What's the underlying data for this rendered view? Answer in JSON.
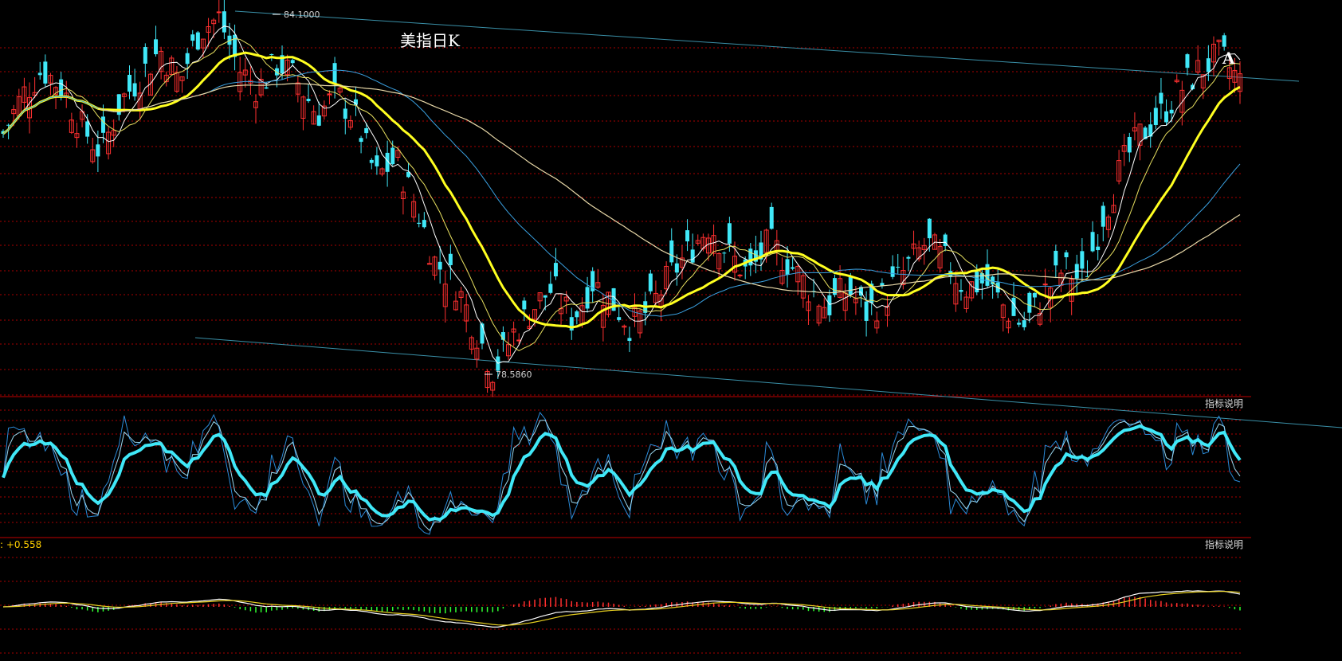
{
  "chart_data": {
    "type": "candlestick",
    "title": "美指日K",
    "annotation_mark": "A",
    "high_label": "84.1000",
    "low_label": "78.5860",
    "high_value": 84.1,
    "low_value": 78.586,
    "panel_button_label": "指标说明",
    "macd_label": ": +0.558",
    "colors": {
      "background": "#000000",
      "up": "#ff3030",
      "down": "#40e8f8",
      "ma_white": "#ffffff",
      "ma_yellow_thin": "#e8e060",
      "ma_yellow_thick": "#ffff20",
      "ma_blue": "#3aa0e0",
      "ma_beige": "#e8d8a8",
      "grid": "#aa0000",
      "channel": "#3a90a8",
      "kdj_thick": "#40e8f8",
      "macd_pos": "#ff3030",
      "macd_neg": "#30ff30"
    },
    "price_path": [
      82.3,
      82.9,
      83.3,
      83.0,
      82.4,
      82.0,
      82.8,
      83.2,
      83.6,
      83.1,
      83.9,
      84.1,
      83.3,
      83.0,
      83.4,
      83.1,
      82.6,
      82.9,
      82.5,
      81.6,
      81.9,
      81.2,
      80.3,
      80.0,
      79.3,
      78.6,
      79.2,
      79.6,
      79.9,
      79.4,
      80.0,
      79.7,
      79.3,
      79.6,
      80.1,
      80.5,
      80.9,
      80.4,
      80.1,
      80.6,
      80.3,
      79.9,
      79.6,
      79.9,
      79.5,
      79.8,
      80.2,
      80.6,
      80.3,
      79.9,
      80.0,
      79.6,
      79.3,
      79.8,
      80.2,
      80.0,
      81.0,
      81.8,
      82.3,
      82.6,
      83.0,
      83.3,
      83.5,
      83.1
    ]
  }
}
